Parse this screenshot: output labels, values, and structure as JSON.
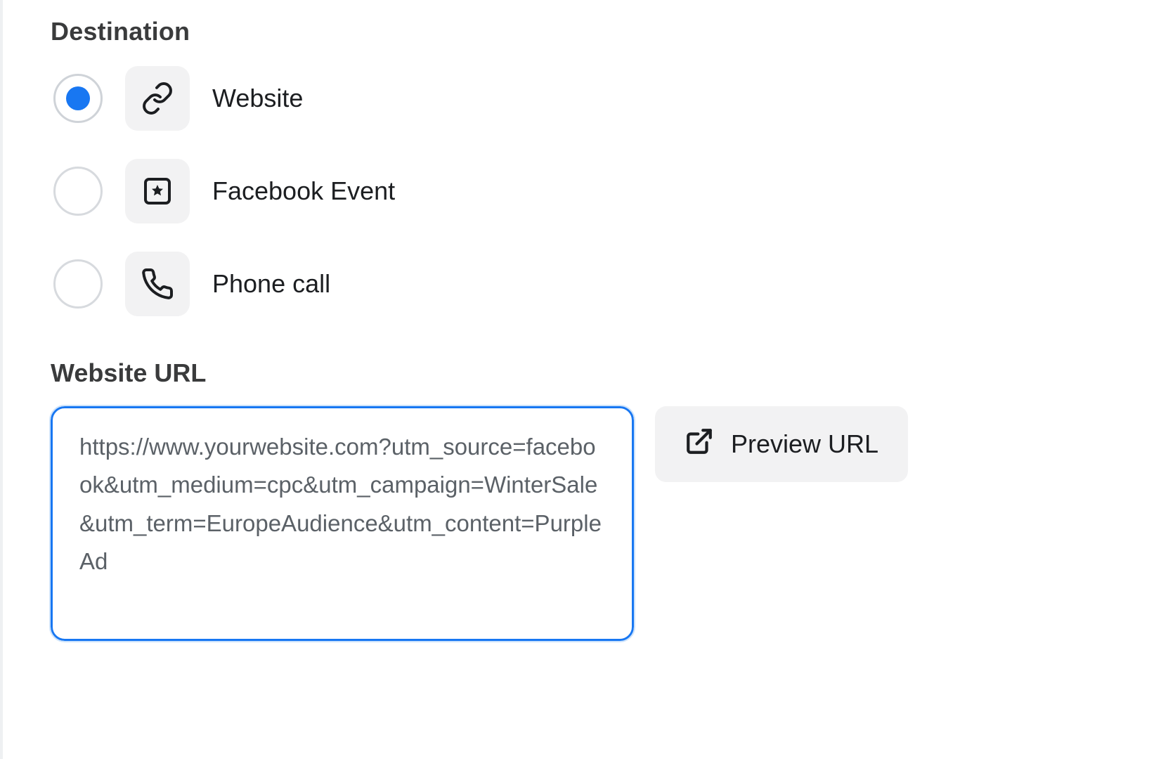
{
  "destination": {
    "heading": "Destination",
    "options": [
      {
        "label": "Website",
        "selected": true,
        "icon": "link-icon"
      },
      {
        "label": "Facebook Event",
        "selected": false,
        "icon": "event-icon"
      },
      {
        "label": "Phone call",
        "selected": false,
        "icon": "phone-icon"
      }
    ]
  },
  "website_url": {
    "heading": "Website URL",
    "value": "https://www.yourwebsite.com?utm_source=facebook&utm_medium=cpc&utm_campaign=WinterSale&utm_term=EuropeAudience&utm_content=PurpleAd",
    "preview_label": "Preview URL"
  }
}
